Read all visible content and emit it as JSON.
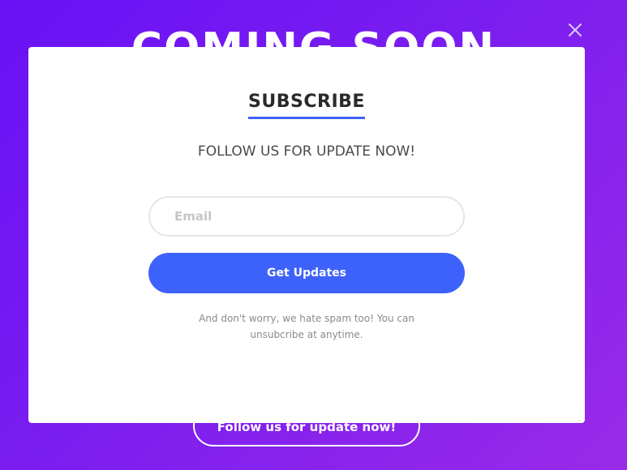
{
  "background": {
    "title": "COMING SOON",
    "follow_button_label": "Follow us for update now!",
    "gradient_colors": [
      "#6a11f5",
      "#9a2ae8"
    ]
  },
  "close": {
    "icon": "close-icon"
  },
  "modal": {
    "heading": "SUBSCRIBE",
    "subheading": "FOLLOW US FOR UPDATE NOW!",
    "email_placeholder": "Email",
    "email_value": "",
    "submit_label": "Get Updates",
    "note": "And don't worry, we hate spam too! You can unsubcribe at anytime.",
    "accent_color": "#3d62fb"
  }
}
